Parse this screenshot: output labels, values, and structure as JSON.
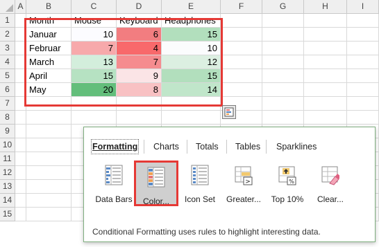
{
  "columns": [
    "A",
    "B",
    "C",
    "D",
    "E",
    "F",
    "G",
    "H",
    "I"
  ],
  "rows": [
    "1",
    "2",
    "3",
    "4",
    "5",
    "6",
    "7",
    "8",
    "9",
    "10",
    "11",
    "12",
    "13",
    "14",
    "15"
  ],
  "table": {
    "headers": [
      "Month",
      "Mouse",
      "Keyboard",
      "Headphones"
    ],
    "rows": [
      {
        "month": "Januar",
        "mouse": "10",
        "keyboard": "6",
        "headphones": "15"
      },
      {
        "month": "Februar",
        "mouse": "7",
        "keyboard": "4",
        "headphones": "10"
      },
      {
        "month": "March",
        "mouse": "13",
        "keyboard": "7",
        "headphones": "12"
      },
      {
        "month": "April",
        "mouse": "15",
        "keyboard": "9",
        "headphones": "15"
      },
      {
        "month": "May",
        "mouse": "20",
        "keyboard": "8",
        "headphones": "14"
      }
    ],
    "colors": {
      "mouse": [
        "#fcfcff",
        "#f7a9ab",
        "#d3eedc",
        "#b6e2c2",
        "#63be7b"
      ],
      "keyboard": [
        "#f27d80",
        "#f8696b",
        "#f58c8f",
        "#fbe4e6",
        "#f8c1c3"
      ],
      "headphones": [
        "#b2dfbd",
        "#fbfcfd",
        "#dcefe1",
        "#b2dfbd",
        "#c0e6ca"
      ]
    }
  },
  "quick_analysis": {
    "tabs": [
      "Formatting",
      "Charts",
      "Totals",
      "Tables",
      "Sparklines"
    ],
    "active_tab": "Formatting",
    "tools": [
      "Data Bars",
      "Color...",
      "Icon Set",
      "Greater...",
      "Top 10%",
      "Clear..."
    ],
    "tool_icons": [
      "data-bars-icon",
      "color-scale-icon",
      "icon-set-icon",
      "greater-than-icon",
      "top-10-icon",
      "clear-format-icon"
    ],
    "description": "Conditional Formatting uses rules to highlight interesting data."
  },
  "accent_color": "#e53935"
}
